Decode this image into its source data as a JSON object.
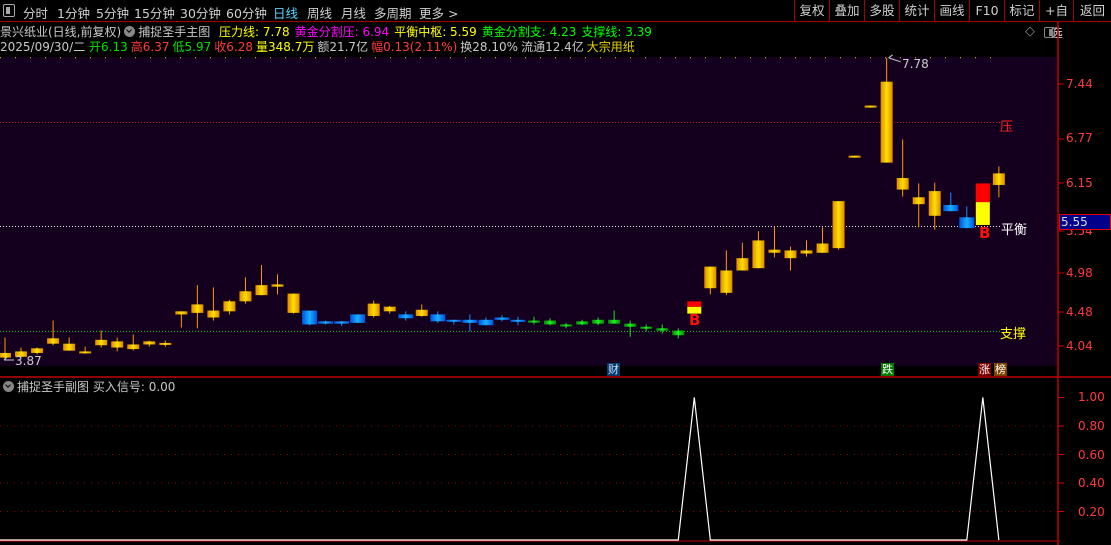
{
  "toolbar": {
    "tabs": [
      "分时",
      "1分钟",
      "5分钟",
      "15分钟",
      "30分钟",
      "60分钟",
      "日线",
      "周线",
      "月线",
      "多周期",
      "更多 >"
    ],
    "active_tab": "日线",
    "buttons": [
      "复权",
      "叠加",
      "多股",
      "统计",
      "画线",
      "F10",
      "标记",
      "+自选",
      "返回"
    ]
  },
  "header": {
    "stock": "景兴纸业(日线,前复权)",
    "indicator": "捕捉圣手主图",
    "lines": [
      {
        "label": "压力线: 7.78",
        "color": "#ffff00"
      },
      {
        "label": "黄金分割压: 6.94",
        "color": "#ff00ff"
      },
      {
        "label": "平衡中枢: 5.59",
        "color": "#ffff00"
      },
      {
        "label": "黄金分割支: 4.23",
        "color": "#00ff00"
      },
      {
        "label": "支撑线: 3.39",
        "color": "#00ff00"
      }
    ],
    "date": "2025/09/30/二",
    "quote": [
      {
        "label": "开6.13",
        "color": "#00e000"
      },
      {
        "label": "高6.37",
        "color": "#ff3b3b"
      },
      {
        "label": "低5.97",
        "color": "#00e000"
      },
      {
        "label": "收6.28",
        "color": "#ff3b3b"
      },
      {
        "label": "量348.7万",
        "color": "#ffff00"
      },
      {
        "label": "额21.7亿",
        "color": "#c8c8c8"
      },
      {
        "label": "幅0.13(2.11%)",
        "color": "#ff3b3b"
      },
      {
        "label": "换28.10%",
        "color": "#c8c8c8"
      },
      {
        "label": "流通12.4亿",
        "color": "#c8c8c8"
      },
      {
        "label": "大宗用纸",
        "color": "#e6d200"
      }
    ]
  },
  "main_chart": {
    "price_axis": [
      "7.44",
      "6.77",
      "6.15",
      "5.54",
      "4.98",
      "4.48",
      "4.04"
    ],
    "current_price": "5.55",
    "high_label": "7.78",
    "low_label": "3.87",
    "level_labels": {
      "pressure": "压",
      "balance": "平衡",
      "support": "支撑"
    },
    "signal_label": "B",
    "event_tags": [
      "财",
      "跌",
      "涨",
      "榜"
    ]
  },
  "sub_chart": {
    "title": "捕捉圣手副图",
    "value_label": "买入信号: 0.00",
    "axis": [
      "1.00",
      "0.80",
      "0.60",
      "0.40",
      "0.20"
    ]
  },
  "chart_data": {
    "type": "candlestick",
    "ylim": [
      3.72,
      7.8
    ],
    "levels": {
      "pressure_top": 7.78,
      "pressure": 6.94,
      "balance": 5.59,
      "support": 4.23
    },
    "candles": [
      [
        3.89,
        4.15,
        3.87,
        3.95,
        "up"
      ],
      [
        3.9,
        4.02,
        3.9,
        3.97,
        "up"
      ],
      [
        3.95,
        4.02,
        3.93,
        4.01,
        "up"
      ],
      [
        4.07,
        4.37,
        4.05,
        4.14,
        "up"
      ],
      [
        3.98,
        4.15,
        3.98,
        4.07,
        "up"
      ],
      [
        3.96,
        4.03,
        3.94,
        3.97,
        "up"
      ],
      [
        4.05,
        4.24,
        4.02,
        4.12,
        "up"
      ],
      [
        4.02,
        4.15,
        3.97,
        4.1,
        "up"
      ],
      [
        4.0,
        4.19,
        3.98,
        4.06,
        "up"
      ],
      [
        4.06,
        4.11,
        4.03,
        4.1,
        "up"
      ],
      [
        4.07,
        4.11,
        4.03,
        4.08,
        "up"
      ],
      [
        4.45,
        4.49,
        4.28,
        4.49,
        "up"
      ],
      [
        4.47,
        4.83,
        4.27,
        4.58,
        "up"
      ],
      [
        4.41,
        4.8,
        4.37,
        4.5,
        "up"
      ],
      [
        4.49,
        4.64,
        4.45,
        4.62,
        "up"
      ],
      [
        4.62,
        4.93,
        4.59,
        4.75,
        "up"
      ],
      [
        4.7,
        5.09,
        4.7,
        4.83,
        "up"
      ],
      [
        4.81,
        4.97,
        4.71,
        4.84,
        "up"
      ],
      [
        4.72,
        4.72,
        4.46,
        4.47,
        "up"
      ],
      [
        4.5,
        4.5,
        4.31,
        4.32,
        "down"
      ],
      [
        4.36,
        4.37,
        4.32,
        4.33,
        "down"
      ],
      [
        4.36,
        4.36,
        4.3,
        4.33,
        "down"
      ],
      [
        4.45,
        4.45,
        4.34,
        4.34,
        "down"
      ],
      [
        4.43,
        4.63,
        4.41,
        4.59,
        "up"
      ],
      [
        4.49,
        4.56,
        4.46,
        4.55,
        "up"
      ],
      [
        4.45,
        4.49,
        4.37,
        4.4,
        "down"
      ],
      [
        4.43,
        4.58,
        4.42,
        4.51,
        "up"
      ],
      [
        4.45,
        4.49,
        4.34,
        4.36,
        "down"
      ],
      [
        4.38,
        4.38,
        4.32,
        4.36,
        "down"
      ],
      [
        4.38,
        4.45,
        4.23,
        4.34,
        "down"
      ],
      [
        4.38,
        4.41,
        4.31,
        4.31,
        "down"
      ],
      [
        4.41,
        4.44,
        4.36,
        4.38,
        "down"
      ],
      [
        4.38,
        4.42,
        4.31,
        4.36,
        "down"
      ],
      [
        4.37,
        4.42,
        4.32,
        4.37,
        "weak"
      ],
      [
        4.37,
        4.4,
        4.31,
        4.32,
        "weak"
      ],
      [
        4.32,
        4.34,
        4.27,
        4.31,
        "weak"
      ],
      [
        4.36,
        4.38,
        4.31,
        4.32,
        "weak"
      ],
      [
        4.38,
        4.41,
        4.31,
        4.33,
        "weak"
      ],
      [
        4.38,
        4.5,
        4.33,
        4.33,
        "weak"
      ],
      [
        4.33,
        4.37,
        4.16,
        4.29,
        "weak"
      ],
      [
        4.29,
        4.32,
        4.23,
        4.27,
        "weak"
      ],
      [
        4.27,
        4.32,
        4.2,
        4.24,
        "weak"
      ],
      [
        4.24,
        4.27,
        4.14,
        4.18,
        "weak"
      ],
      [
        4.46,
        4.62,
        4.46,
        4.62,
        "signal"
      ],
      [
        4.79,
        5.07,
        4.71,
        5.07,
        "up"
      ],
      [
        4.73,
        5.28,
        4.7,
        5.02,
        "up"
      ],
      [
        5.02,
        5.38,
        5.02,
        5.18,
        "up"
      ],
      [
        5.05,
        5.53,
        5.05,
        5.41,
        "up"
      ],
      [
        5.25,
        5.59,
        5.19,
        5.29,
        "up"
      ],
      [
        5.18,
        5.33,
        5.02,
        5.28,
        "up"
      ],
      [
        5.24,
        5.41,
        5.2,
        5.28,
        "up"
      ],
      [
        5.25,
        5.58,
        5.25,
        5.37,
        "up"
      ],
      [
        5.31,
        5.92,
        5.29,
        5.92,
        "up"
      ],
      [
        6.5,
        6.51,
        6.5,
        6.51,
        "up"
      ],
      [
        7.15,
        7.16,
        7.15,
        7.16,
        "up"
      ],
      [
        6.42,
        7.78,
        6.42,
        7.47,
        "up"
      ],
      [
        6.07,
        6.72,
        5.98,
        6.22,
        "up"
      ],
      [
        5.88,
        6.15,
        5.58,
        5.97,
        "up"
      ],
      [
        5.73,
        6.16,
        5.55,
        6.05,
        "up"
      ],
      [
        5.87,
        6.03,
        5.79,
        5.79,
        "down"
      ],
      [
        5.71,
        5.85,
        5.57,
        5.57,
        "down"
      ],
      [
        5.61,
        6.15,
        5.61,
        6.15,
        "signal"
      ],
      [
        6.13,
        6.37,
        5.97,
        6.28,
        "up"
      ]
    ],
    "buy_signal_index": [
      43,
      61
    ],
    "sub_ylim": [
      0,
      1.1
    ]
  }
}
